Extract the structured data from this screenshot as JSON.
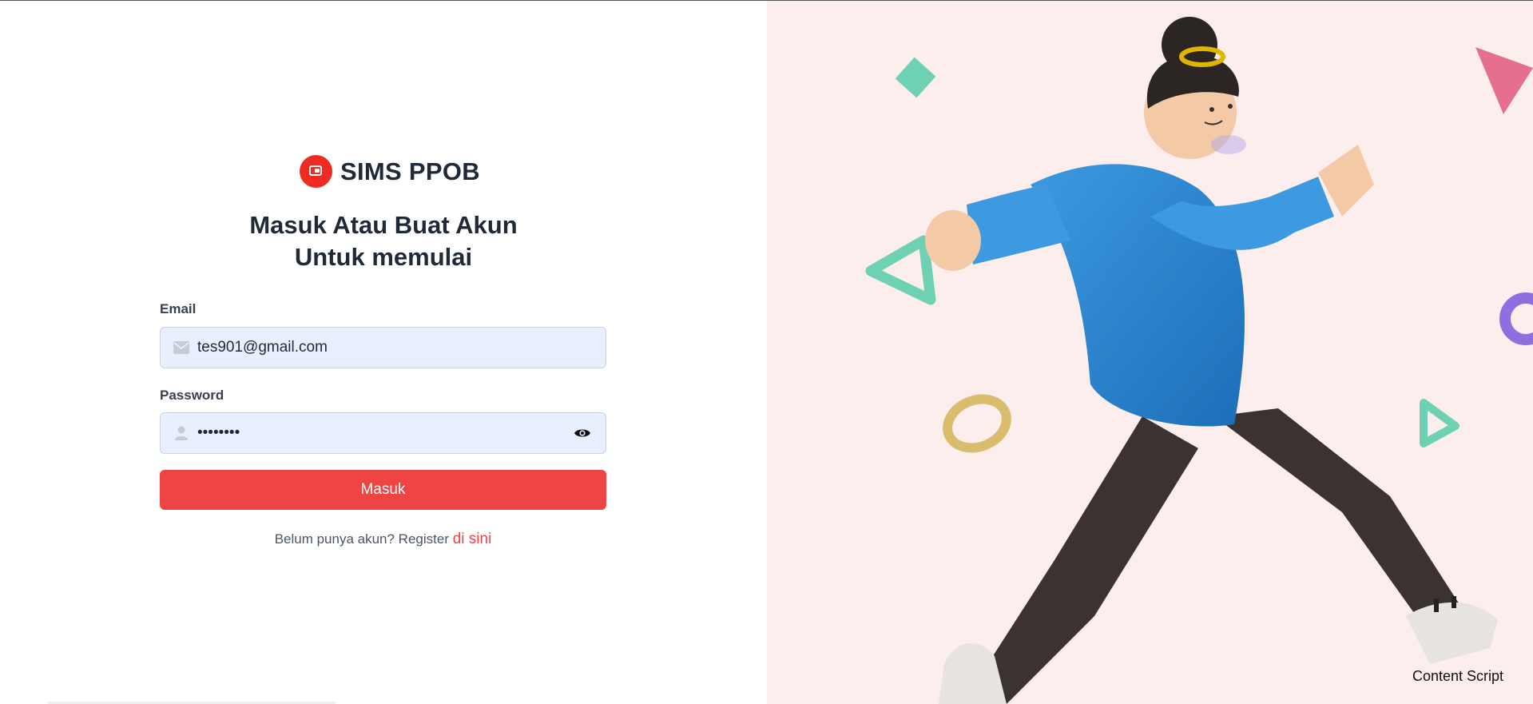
{
  "brand": {
    "name": "SIMS PPOB"
  },
  "heading": {
    "line1": "Masuk Atau Buat Akun",
    "line2": "Untuk memulai"
  },
  "form": {
    "email_label": "Email",
    "email_value": "tes901@gmail.com",
    "password_label": "Password",
    "password_value": "••••••••",
    "submit_label": "Masuk"
  },
  "register": {
    "text": "Belum punya akun? Register ",
    "link": "di sini"
  },
  "overlay": {
    "content_script": "Content Script"
  },
  "icons": {
    "logo": "wallet-icon",
    "email": "envelope-icon",
    "password": "user-icon",
    "toggle": "eye-icon"
  },
  "colors": {
    "accent": "#ef4444",
    "logo": "#ef2c23",
    "input_bg": "#e8effd",
    "illustration_bg": "#fdeeee"
  }
}
